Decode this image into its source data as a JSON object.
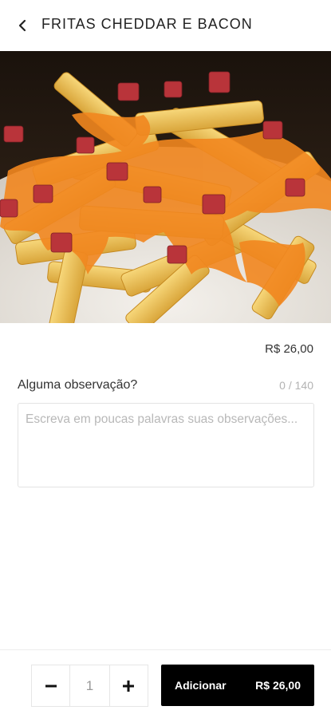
{
  "header": {
    "title": "FRITAS CHEDDAR E BACON",
    "back_icon": "chevron-left-icon"
  },
  "product": {
    "image_subject": "fries-with-cheddar-and-bacon",
    "price": "R$ 26,00"
  },
  "observation": {
    "label": "Alguma observação?",
    "counter": "0 / 140",
    "placeholder": "Escreva em poucas palavras suas observações...",
    "value": ""
  },
  "footer": {
    "quantity": "1",
    "decrement_icon": "minus-icon",
    "increment_icon": "plus-icon",
    "add_label": "Adicionar",
    "add_price": "R$ 26,00",
    "button_color": "#000000"
  }
}
